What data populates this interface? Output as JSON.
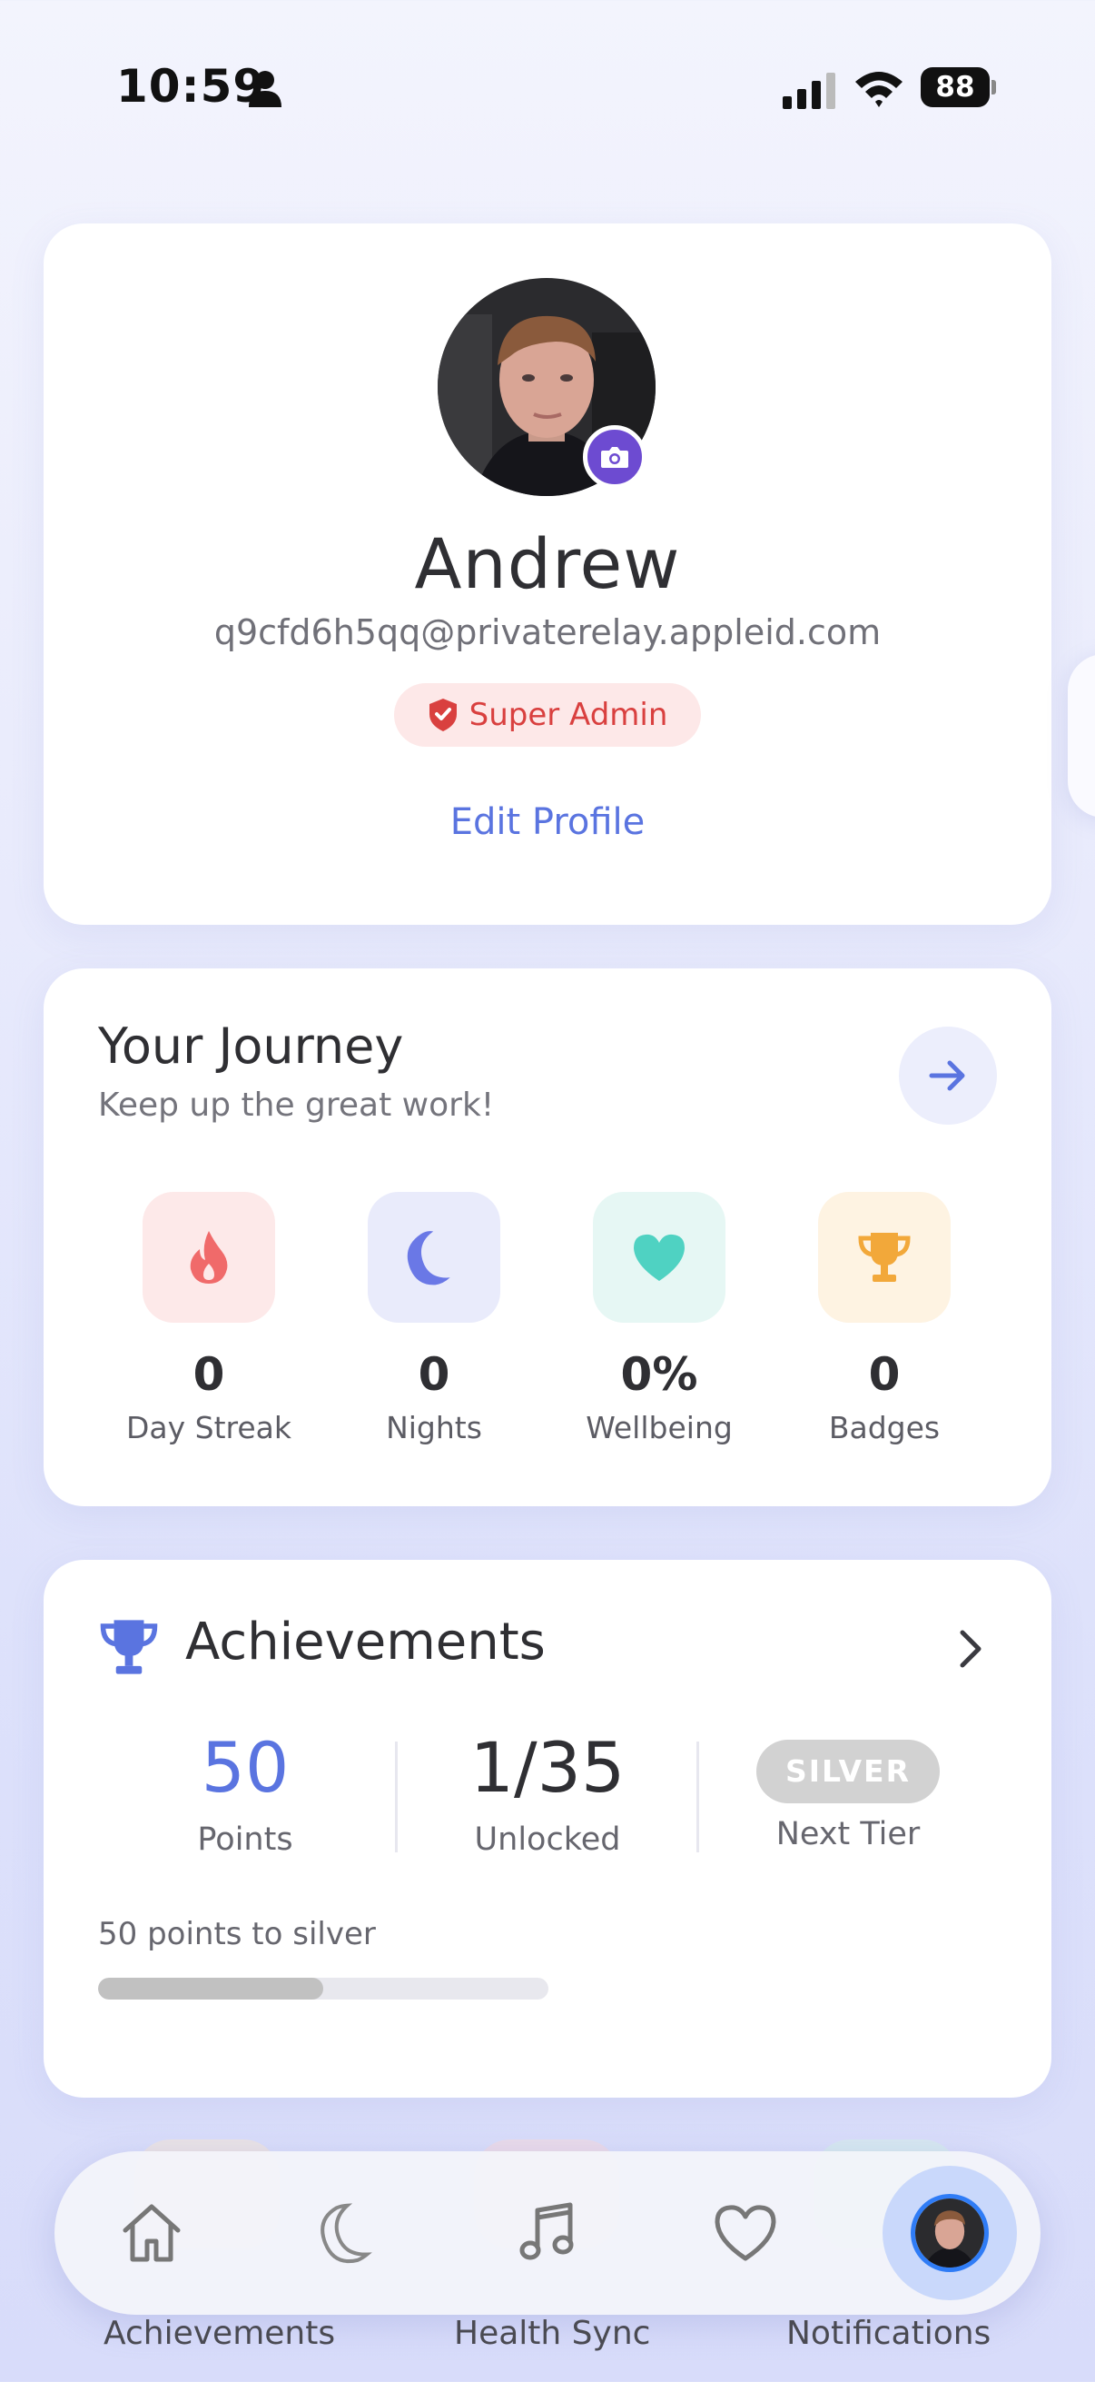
{
  "status_bar": {
    "time": "10:59",
    "battery": "88"
  },
  "profile": {
    "name": "Andrew",
    "email": "q9cfd6h5qq@privaterelay.appleid.com",
    "role": "Super Admin",
    "edit_label": "Edit Profile"
  },
  "journey": {
    "title": "Your Journey",
    "subtitle": "Keep up the great work!",
    "stats": [
      {
        "icon": "flame-icon",
        "value": "0",
        "label": "Day Streak",
        "color": "#f06a6a"
      },
      {
        "icon": "moon-icon",
        "value": "0",
        "label": "Nights",
        "color": "#6a78e6"
      },
      {
        "icon": "heart-icon",
        "value": "0%",
        "label": "Wellbeing",
        "color": "#4fd2c2"
      },
      {
        "icon": "trophy-icon",
        "value": "0",
        "label": "Badges",
        "color": "#f2a83a"
      }
    ]
  },
  "achievements": {
    "title": "Achievements",
    "points": "50",
    "points_label": "Points",
    "unlocked": "1/35",
    "unlocked_label": "Unlocked",
    "next_tier": "SILVER",
    "next_tier_label": "Next Tier",
    "progress_text": "50 points to silver",
    "progress_fraction": 0.5
  },
  "tab_bar": {
    "tabs": [
      "home-icon",
      "moon-icon",
      "music-note-icon",
      "heart-icon",
      "avatar"
    ]
  },
  "bottom_labels": {
    "left": "Achievements",
    "center": "Health Sync",
    "right": "Notifications"
  },
  "colors": {
    "accent": "#5a74e0",
    "camera": "#6d4bd1",
    "role_red": "#d9403f",
    "tier_grey": "#d2d2d2"
  }
}
